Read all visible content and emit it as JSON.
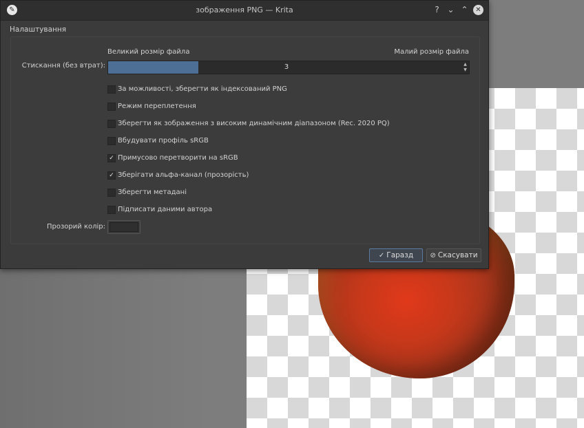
{
  "window": {
    "title": "зображення PNG — Krita",
    "buttons": {
      "help": "?",
      "minimize": "⌄",
      "maximize": "⌃",
      "close": "✕"
    }
  },
  "group": {
    "title": "Налаштування"
  },
  "compression": {
    "label": "Стискання (без втрат):",
    "left_hint": "Великий розмір файла",
    "right_hint": "Малий розмір файла",
    "value": "3",
    "fraction": 0.25
  },
  "options": [
    {
      "label": "За можливості, зберегти як індексований PNG",
      "checked": false
    },
    {
      "label": "Режим переплетення",
      "checked": false
    },
    {
      "label": "Зберегти як зображення з високим динамічним діапазоном (Rec. 2020 PQ)",
      "checked": false
    },
    {
      "label": "Вбудувати профіль sRGB",
      "checked": false
    },
    {
      "label": "Примусово перетворити на sRGB",
      "checked": true
    },
    {
      "label": "Зберігати альфа-канал (прозорість)",
      "checked": true
    },
    {
      "label": "Зберегти метадані",
      "checked": false
    },
    {
      "label": "Підписати даними автора",
      "checked": false
    }
  ],
  "transparent_color": {
    "label": "Прозорий колір:",
    "color": "#2f2f2f"
  },
  "footer": {
    "ok_label": "Гаразд",
    "cancel_label": "Скасувати"
  },
  "colors": {
    "accent": "#4d6f96",
    "dialog_bg": "#3b3b3b"
  }
}
